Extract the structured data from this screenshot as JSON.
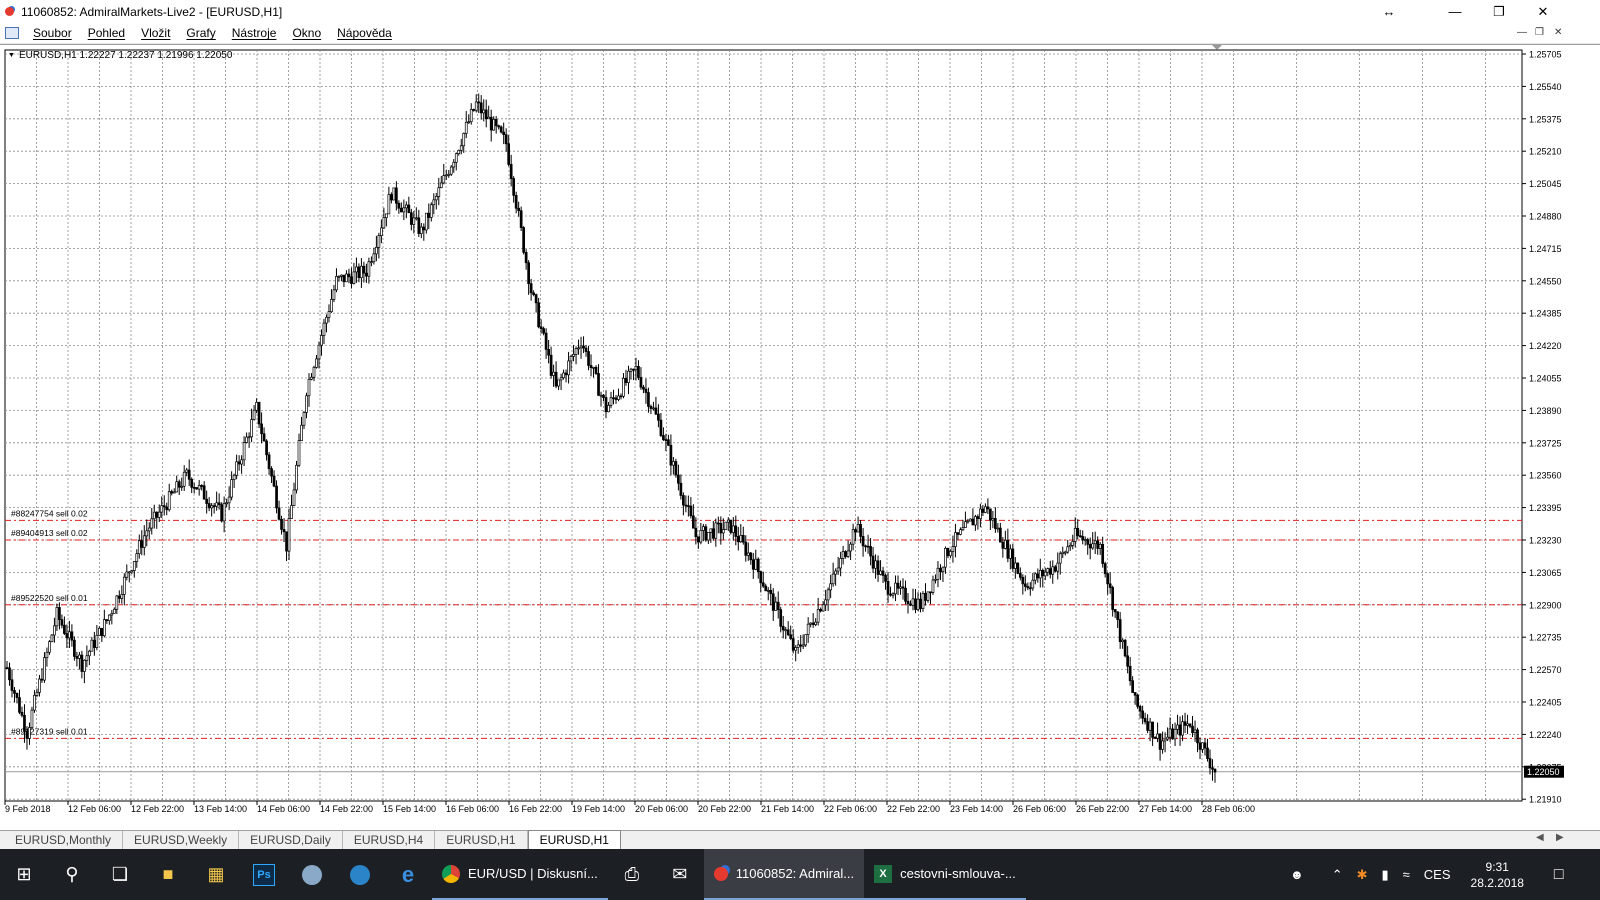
{
  "window": {
    "title": "11060852: AdmiralMarkets-Live2 - [EURUSD,H1]"
  },
  "menu": [
    "Soubor",
    "Pohled",
    "Vložit",
    "Grafy",
    "Nástroje",
    "Okno",
    "Nápověda"
  ],
  "chart": {
    "info_label": "EURUSD,H1  1.22227 1.22237 1.21996 1.22050",
    "current_price": "1.22050",
    "price_ticks": [
      "1.25705",
      "1.25540",
      "1.25375",
      "1.25210",
      "1.25045",
      "1.24880",
      "1.24715",
      "1.24550",
      "1.24385",
      "1.24220",
      "1.24055",
      "1.23890",
      "1.23725",
      "1.23560",
      "1.23395",
      "1.23230",
      "1.23065",
      "1.22900",
      "1.22735",
      "1.22570",
      "1.22405",
      "1.22240",
      "1.22075",
      "1.21910"
    ],
    "time_ticks": [
      "9 Feb 2018",
      "12 Feb 06:00",
      "12 Feb 22:00",
      "13 Feb 14:00",
      "14 Feb 06:00",
      "14 Feb 22:00",
      "15 Feb 14:00",
      "16 Feb 06:00",
      "16 Feb 22:00",
      "19 Feb 14:00",
      "20 Feb 06:00",
      "20 Feb 22:00",
      "21 Feb 14:00",
      "22 Feb 06:00",
      "22 Feb 22:00",
      "23 Feb 14:00",
      "26 Feb 06:00",
      "26 Feb 22:00",
      "27 Feb 14:00",
      "28 Feb 06:00"
    ],
    "orders": [
      {
        "label": "#88247754 sell 0.02",
        "price": 1.2333
      },
      {
        "label": "#89404913 sell 0.02",
        "price": 1.2323
      },
      {
        "label": "#89522520 sell 0.01",
        "price": 1.229
      },
      {
        "label": "#89127319 sell 0.01",
        "price": 1.2222
      }
    ],
    "colors": {
      "grid": "#8c8c8c",
      "candle": "#000000",
      "order_line": "#e02020"
    }
  },
  "chart_data": {
    "type": "candlestick",
    "symbol": "EURUSD",
    "timeframe": "H1",
    "ylim": [
      1.2191,
      1.25705
    ],
    "candles": 332,
    "path": [
      [
        0,
        1.2258
      ],
      [
        8,
        1.2225
      ],
      [
        20,
        1.2285
      ],
      [
        30,
        1.226
      ],
      [
        40,
        1.2282
      ],
      [
        56,
        1.2328
      ],
      [
        72,
        1.2356
      ],
      [
        86,
        1.2336
      ],
      [
        100,
        1.239
      ],
      [
        112,
        1.232
      ],
      [
        120,
        1.24
      ],
      [
        132,
        1.2455
      ],
      [
        144,
        1.246
      ],
      [
        154,
        1.25
      ],
      [
        166,
        1.248
      ],
      [
        178,
        1.2515
      ],
      [
        188,
        1.2545
      ],
      [
        200,
        1.2525
      ],
      [
        210,
        1.245
      ],
      [
        220,
        1.24
      ],
      [
        230,
        1.2425
      ],
      [
        240,
        1.239
      ],
      [
        252,
        1.241
      ],
      [
        262,
        1.238
      ],
      [
        276,
        1.2325
      ],
      [
        290,
        1.233
      ],
      [
        300,
        1.231
      ],
      [
        316,
        1.2265
      ],
      [
        330,
        1.23
      ],
      [
        340,
        1.233
      ],
      [
        352,
        1.23
      ],
      [
        366,
        1.229
      ],
      [
        378,
        1.232
      ],
      [
        392,
        1.234
      ],
      [
        408,
        1.23
      ],
      [
        420,
        1.231
      ],
      [
        428,
        1.2325
      ],
      [
        438,
        1.232
      ],
      [
        452,
        1.224
      ],
      [
        462,
        1.222
      ],
      [
        474,
        1.223
      ],
      [
        484,
        1.2205
      ]
    ]
  },
  "tabs": [
    "EURUSD,Monthly",
    "EURUSD,Weekly",
    "EURUSD,Daily",
    "EURUSD,H4",
    "EURUSD,H1",
    "EURUSD,H1"
  ],
  "taskbar": {
    "apps": [
      "EUR/USD | Diskusní...",
      "11060852: Admiral...",
      "cestovni-smlouva-..."
    ],
    "lang": "CES",
    "time": "9:31",
    "date": "28.2.2018"
  }
}
